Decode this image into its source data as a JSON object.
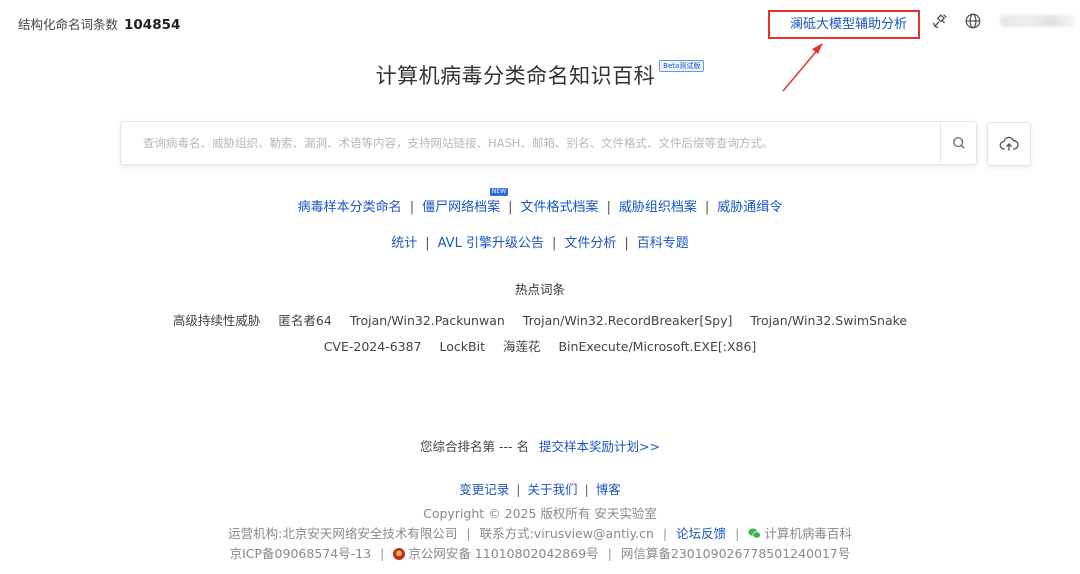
{
  "header": {
    "count_label": "结构化命名词条数",
    "count_value": "104854",
    "ai_link": "澜砥大模型辅助分析",
    "icons": [
      "satellite-icon",
      "globe-icon"
    ],
    "annotation_color": "#e5322d"
  },
  "title": {
    "text": "计算机病毒分类命名知识百科",
    "badge": "Beta测试版"
  },
  "search": {
    "placeholder": "查询病毒名、威胁组织、勒索、漏洞、术语等内容，支持网站链接、HASH、邮箱、别名、文件格式、文件后缀等查询方式。",
    "value": ""
  },
  "nav_primary": [
    {
      "label": "病毒样本分类命名"
    },
    {
      "label": "僵尸网络档案",
      "badge": "NEW"
    },
    {
      "label": "文件格式档案"
    },
    {
      "label": "威胁组织档案"
    },
    {
      "label": "威胁通缉令"
    }
  ],
  "nav_secondary": [
    {
      "label": "统计"
    },
    {
      "label": "AVL 引擎升级公告"
    },
    {
      "label": "文件分析"
    },
    {
      "label": "百科专题"
    }
  ],
  "hot": {
    "title": "热点词条",
    "row1": [
      "高级持续性威胁",
      "匿名者64",
      "Trojan/Win32.Packunwan",
      "Trojan/Win32.RecordBreaker[Spy]",
      "Trojan/Win32.SwimSnake"
    ],
    "row2": [
      "CVE-2024-6387",
      "LockBit",
      "海莲花",
      "BinExecute/Microsoft.EXE[:X86]"
    ]
  },
  "rank": {
    "label": "您综合排名第 --- 名",
    "link": "提交样本奖励计划>>"
  },
  "footer": {
    "links": [
      "变更记录",
      "关于我们",
      "博客"
    ],
    "copyright": "Copyright © 2025 版权所有  安天实验室",
    "operator": "运营机构:北京安天网络安全技术有限公司",
    "contact": "联系方式:virusview@antiy.cn",
    "forum": "论坛反馈",
    "wechat": "计算机病毒百科",
    "icp": "京ICP备09068574号-13",
    "police": "京公网安备 11010802042869号",
    "netinfo": "网信算备230109026778501240017号"
  },
  "colors": {
    "link": "#1a56c4",
    "text": "#333333",
    "muted": "#8a8a8a"
  }
}
